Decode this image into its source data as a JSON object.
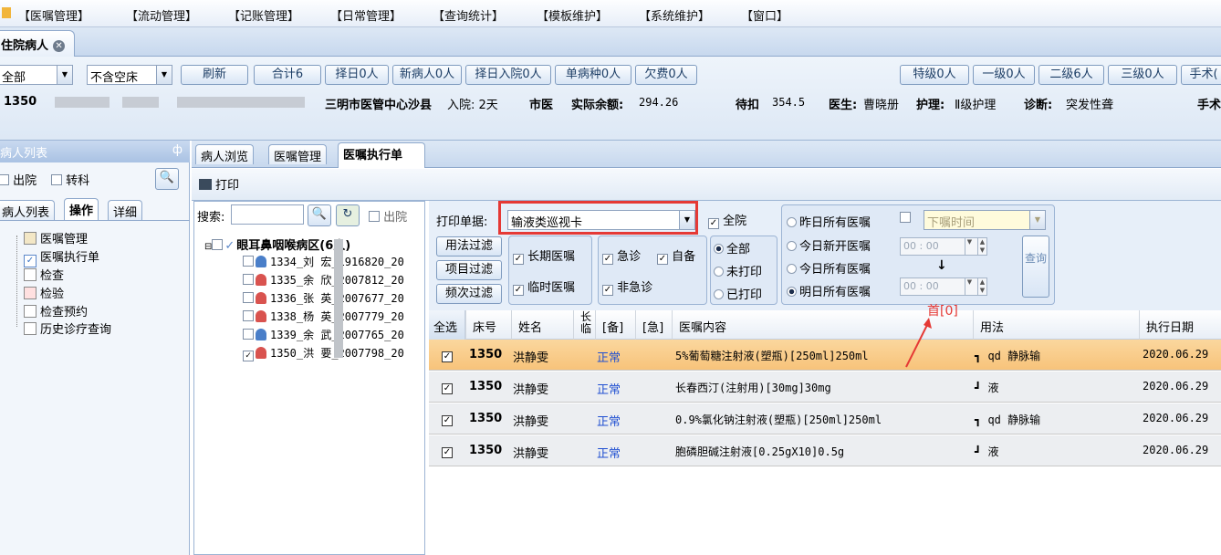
{
  "menu": [
    "【医嘱管理】",
    "【流动管理】",
    "【记账管理】",
    "【日常管理】",
    "【查询统计】",
    "【模板维护】",
    "【系统维护】",
    "【窗口】"
  ],
  "doc_tab": "住院病人",
  "toolbar": {
    "filter_value": "全部",
    "bed_value": "不含空床",
    "buttons": [
      "刷新",
      "合计6",
      "择日0人",
      "新病人0人",
      "择日入院0人",
      "单病种0人",
      "欠费0人"
    ],
    "level_buttons": [
      "特级0人",
      "一级0人",
      "二级6人",
      "三级0人",
      "手术("
    ]
  },
  "patient_info": {
    "bed": "1350",
    "hospital": "三明市医管中心沙县",
    "admit": "入院: 2天",
    "type": "市医",
    "balance_label": "实际余额:",
    "balance": "294.26",
    "pending_label": "待扣",
    "pending": "354.5",
    "doctor_label": "医生:",
    "doctor": "曹晓册",
    "nursing_label": "护理:",
    "nursing": "Ⅱ级护理",
    "diagnosis_label": "诊断:",
    "diagnosis": "突发性聋",
    "surgery_label": "手术"
  },
  "left": {
    "panel_title": "病人列表",
    "pin": "ф",
    "discharged": "出院",
    "transfer": "转科",
    "tabs": [
      "病人列表",
      "操作",
      "详细"
    ],
    "ops": [
      "医嘱管理",
      "医嘱执行单",
      "检查",
      "检验",
      "检查预约",
      "历史诊疗查询"
    ]
  },
  "content_tabs": [
    "病人浏览",
    "医嘱管理",
    "医嘱执行单"
  ],
  "print_label": "打印",
  "mid": {
    "search_label": "搜索:",
    "discharged": "出院",
    "ward": "眼耳鼻咽喉病区(6人)",
    "patients": [
      {
        "text": "1334_刘   宏_1916820_20",
        "checked": false,
        "gender": "m"
      },
      {
        "text": "1335_余   欣_2007812_20",
        "checked": false,
        "gender": "f"
      },
      {
        "text": "1336_张   英_2007677_20",
        "checked": false,
        "gender": "f"
      },
      {
        "text": "1338_杨   英_2007779_20",
        "checked": false,
        "gender": "f"
      },
      {
        "text": "1339_余   武_2007765_20",
        "checked": false,
        "gender": "m"
      },
      {
        "text": "1350_洪   要_2007798_20",
        "checked": true,
        "gender": "f"
      }
    ]
  },
  "filter": {
    "print_doc_label": "打印单据:",
    "print_doc_value": "输液类巡视卡",
    "all_hospital": "全院",
    "filter_buttons": [
      "用法过滤",
      "项目过滤",
      "频次过滤"
    ],
    "long_term": "长期医嘱",
    "temporary": "临时医嘱",
    "urgent": "急诊",
    "self_prepared": "自备",
    "non_urgent": "非急诊",
    "print_opts": [
      "全部",
      "未打印",
      "已打印"
    ],
    "date_opts": [
      "昨日所有医嘱",
      "今日新开医嘱",
      "今日所有医嘱",
      "明日所有医嘱"
    ],
    "order_time": "下嘱时间",
    "time1": "00 : 00",
    "time2": "00 : 00",
    "query": "查询"
  },
  "table": {
    "headers": [
      "全选",
      "床号",
      "姓名",
      "长临",
      "[备]",
      "[急]",
      "医嘱内容",
      "用法",
      "执行日期"
    ],
    "rows": [
      {
        "bed": "1350",
        "name": "洪静雯",
        "status": "正常",
        "content": "5%葡萄糖注射液(塑瓶)[250ml]250ml",
        "usage": "qd 静脉输",
        "date": "2020.06.29"
      },
      {
        "bed": "1350",
        "name": "洪静雯",
        "status": "正常",
        "content": "长春西汀(注射用)[30mg]30mg",
        "usage": "液",
        "date": "2020.06.29"
      },
      {
        "bed": "1350",
        "name": "洪静雯",
        "status": "正常",
        "content": "0.9%氯化钠注射液(塑瓶)[250ml]250ml",
        "usage": "qd 静脉输",
        "date": "2020.06.29"
      },
      {
        "bed": "1350",
        "name": "洪静雯",
        "status": "正常",
        "content": "胞磷胆碱注射液[0.25gX10]0.5g",
        "usage": "液",
        "date": "2020.06.29"
      }
    ]
  },
  "annotation": "首[0]",
  "colors": {
    "accent": "#e53935",
    "selected_row": "#f7c37a",
    "status_blue": "#1f4fd1"
  }
}
